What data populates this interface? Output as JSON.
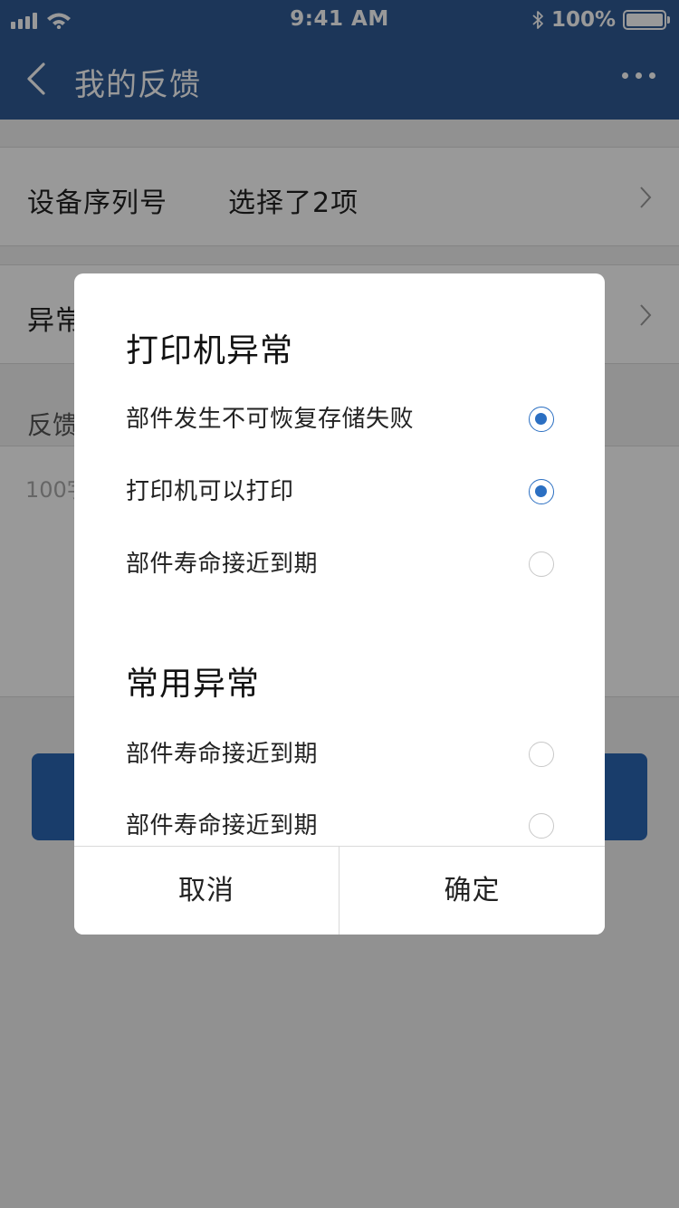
{
  "status_bar": {
    "time": "9:41 AM",
    "battery": "100%",
    "icons": [
      "signal-icon",
      "wifi-icon",
      "bluetooth-icon",
      "battery-icon"
    ]
  },
  "nav": {
    "title": "我的反馈",
    "back_icon": "chevron-left-icon",
    "more_icon": "more-icon"
  },
  "form": {
    "serial_label": "设备序列号",
    "serial_value": "选择了2项",
    "exception_label": "异常",
    "feedback_label": "反馈",
    "feedback_placeholder": "100字"
  },
  "dialog": {
    "groups": [
      {
        "title": "打印机异常",
        "options": [
          {
            "label": "部件发生不可恢复存储失败",
            "checked": true
          },
          {
            "label": "打印机可以打印",
            "checked": true
          },
          {
            "label": "部件寿命接近到期",
            "checked": false
          }
        ]
      },
      {
        "title": "常用异常",
        "options": [
          {
            "label": "部件寿命接近到期",
            "checked": false
          },
          {
            "label": "部件寿命接近到期",
            "checked": false
          }
        ]
      }
    ],
    "cancel_label": "取消",
    "confirm_label": "确定"
  },
  "colors": {
    "nav_bg": "#2f5a94",
    "accent": "#2b6fc2"
  }
}
